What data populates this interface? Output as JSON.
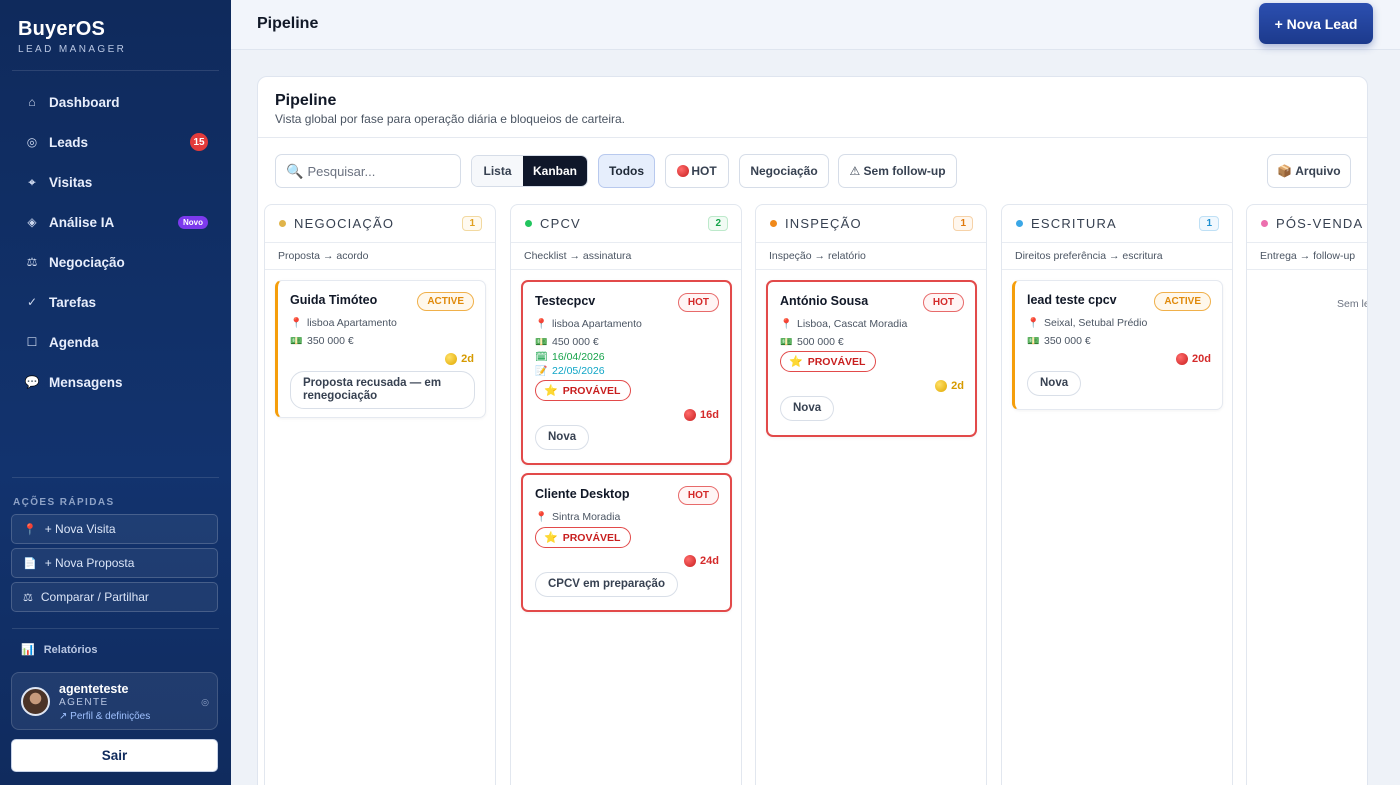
{
  "brand": {
    "name": "BuyerOS",
    "subtitle": "LEAD MANAGER"
  },
  "nav": [
    {
      "label": "Dashboard",
      "icon": "home-icon",
      "glyph": "⌂"
    },
    {
      "label": "Leads",
      "icon": "target-icon",
      "glyph": "◎",
      "badge": "15"
    },
    {
      "label": "Visitas",
      "icon": "crosshair-icon",
      "glyph": "⌖"
    },
    {
      "label": "Análise IA",
      "icon": "diamond-icon",
      "glyph": "◈",
      "pill": "Novo"
    },
    {
      "label": "Negociação",
      "icon": "scale-icon",
      "glyph": "⚖"
    },
    {
      "label": "Tarefas",
      "icon": "check-icon",
      "glyph": "✓"
    },
    {
      "label": "Agenda",
      "icon": "calendar-square-icon",
      "glyph": "☐"
    },
    {
      "label": "Mensagens",
      "icon": "chat-bubble-icon",
      "glyph": "💬"
    }
  ],
  "quick_actions": {
    "title": "AÇÕES RÁPIDAS",
    "items": [
      {
        "label": "+ Nova Visita",
        "icon": "pin-icon",
        "glyph": "📍"
      },
      {
        "label": "+ Nova Proposta",
        "icon": "document-icon",
        "glyph": "📄"
      },
      {
        "label": "Comparar / Partilhar",
        "icon": "scale-icon",
        "glyph": "⚖"
      }
    ]
  },
  "reports": {
    "label": "Relatórios",
    "icon": "bar-chart-icon",
    "glyph": "📊"
  },
  "user": {
    "name": "agenteteste",
    "role": "AGENTE",
    "link": "↗ Perfil & definições"
  },
  "logout_label": "Sair",
  "topbar": {
    "title": "Pipeline",
    "new_lead_label": "+ Nova Lead"
  },
  "panel": {
    "title": "Pipeline",
    "subtitle": "Vista global por fase para operação diária e bloqueios de carteira.",
    "search_placeholder": "Pesquisar...",
    "views": [
      "Lista",
      "Kanban"
    ],
    "active_view": "Kanban",
    "filters": {
      "all": "Todos",
      "hot": "HOT",
      "negotiation": "Negociação",
      "no_followup": "⚠ Sem follow-up",
      "archive": "📦 Arquivo"
    }
  },
  "columns": [
    {
      "name": "NEGOCIAÇÃO",
      "count": "1",
      "color": "#e0b44a",
      "hint": "Proposta → acordo",
      "cards": [
        {
          "name": "Guida Timóteo",
          "tag": "ACTIVE",
          "location": "lisboa  Apartamento",
          "price": "350 000 €",
          "age": "2d",
          "status": "Proposta recusada — em renegociação"
        }
      ]
    },
    {
      "name": "CPCV",
      "count": "2",
      "color": "#22c55e",
      "hint": "Checklist → assinatura",
      "cards": [
        {
          "name": "Testecpcv",
          "tag": "HOT",
          "location": "lisboa  Apartamento",
          "price": "450 000 €",
          "date1": "16/04/2026",
          "date2": "22/05/2026",
          "probability": "PROVÁVEL",
          "age": "16d",
          "status": "Nova"
        },
        {
          "name": "Cliente Desktop",
          "tag": "HOT",
          "location": "Sintra  Moradia",
          "probability": "PROVÁVEL",
          "age": "24d",
          "status": "CPCV em preparação"
        }
      ]
    },
    {
      "name": "INSPEÇÃO",
      "count": "1",
      "color": "#f0891a",
      "hint": "Inspeção → relatório",
      "cards": [
        {
          "name": "António Sousa",
          "tag": "HOT",
          "location": "Lisboa, Cascat  Moradia",
          "price": "500 000 €",
          "probability": "PROVÁVEL",
          "age": "2d",
          "status": "Nova"
        }
      ]
    },
    {
      "name": "ESCRITURA",
      "count": "1",
      "color": "#3ba7e6",
      "hint": "Direitos preferência → escritura",
      "cards": [
        {
          "name": "lead teste cpcv",
          "tag": "ACTIVE",
          "location": "Seixal, Setubal  Prédio",
          "price": "350 000 €",
          "age": "20d",
          "status": "Nova"
        }
      ]
    },
    {
      "name": "PÓS-VENDA",
      "count": "",
      "color": "#ec6fae",
      "hint": "Entrega → follow-up",
      "empty": "Sem le"
    }
  ]
}
